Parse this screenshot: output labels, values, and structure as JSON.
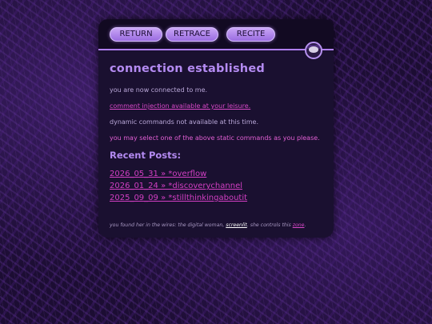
{
  "nav": {
    "buttons": [
      "RETURN",
      "RETRACE",
      "RECITE"
    ]
  },
  "main": {
    "title": "connection established",
    "lines": [
      "you are now connected to me.",
      "comment injection available at your leisure.",
      "dynamic commands not available at this time.",
      "you may select one of the above static commands as you please."
    ],
    "recent_heading": "Recent Posts:",
    "posts": [
      "2026_05_31 » *overflow",
      "2026_01_24 » *discoverychannel",
      "2025_09_09 » *stillthinkingaboutit"
    ]
  },
  "footer": {
    "text_before": "you found her in the wires: the digital woman, ",
    "credit": "screenlit",
    "text_middle": ". she controls this ",
    "zone": "zone",
    "text_after": "."
  },
  "colors": {
    "accent": "#b48bf2",
    "link": "#d23fc3",
    "background": "#1c0d33"
  },
  "icons": {
    "avatar": "avatar-portrait"
  }
}
